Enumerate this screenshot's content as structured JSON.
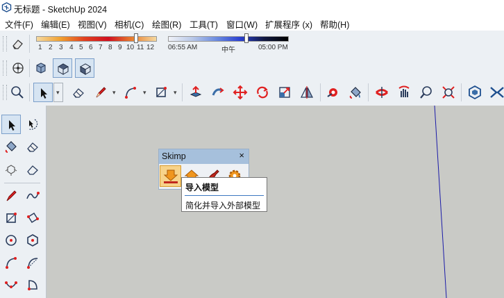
{
  "window": {
    "title": "无标题 - SketchUp 2024",
    "logo_icon": "sketchup-logo-icon"
  },
  "menubar": {
    "items": [
      "文件(F)",
      "编辑(E)",
      "视图(V)",
      "相机(C)",
      "绘图(R)",
      "工具(T)",
      "窗口(W)",
      "扩展程序 (x)",
      "帮助(H)"
    ]
  },
  "shadow_toolbar": {
    "month_labels": [
      "1",
      "2",
      "3",
      "4",
      "5",
      "6",
      "7",
      "8",
      "9",
      "10",
      "11",
      "12"
    ],
    "time_labels": [
      "06:55 AM",
      "中午",
      "05:00 PM"
    ],
    "icons": [
      "shadow-eraser-icon"
    ]
  },
  "camera_toolbar": {
    "icons": [
      "position-camera-icon",
      "iso-view-icon",
      "top-view-icon",
      "front-view-icon"
    ]
  },
  "main_toolbar": {
    "icons": [
      "zoom-magnifier-icon",
      "select-arrow-icon",
      "eraser-icon",
      "pencil-line-icon",
      "arc-icon",
      "rectangle-icon",
      "push-pull-icon",
      "follow-me-icon",
      "move-icon",
      "rotate-icon",
      "scale-icon",
      "protractor-icon",
      "tape-measure-icon",
      "paint-bucket-icon",
      "section-plane-icon",
      "orbit-icon",
      "zoom-icon",
      "zoom-extents-icon",
      "warehouse-icon",
      "extension-icon"
    ]
  },
  "left_toolbar": {
    "icons": [
      "select-icon",
      "lasso-icon",
      "paint-bucket-icon",
      "eraser-icon",
      "tag-cube-icon",
      "eraser-outline-icon",
      "line-icon",
      "freehand-icon",
      "rectangle-icon",
      "rotated-rectangle-icon",
      "circle-icon",
      "polygon-icon",
      "arc-icon",
      "two-point-arc-icon",
      "three-point-arc-icon",
      "pie-icon"
    ]
  },
  "skimp_panel": {
    "title": "Skimp",
    "close_label": "×",
    "icons": [
      "import-model-icon",
      "house-icon",
      "brush-icon",
      "gear-icon"
    ]
  },
  "tooltip": {
    "title": "导入模型",
    "description": "简化并导入外部模型"
  },
  "colors": {
    "accent": "#7b9fca",
    "canvas": "#c9cac6",
    "toolbar": "#ecf0f4",
    "skimp_header": "#a6c0dc",
    "tooltip_rule": "#3c78c0"
  }
}
